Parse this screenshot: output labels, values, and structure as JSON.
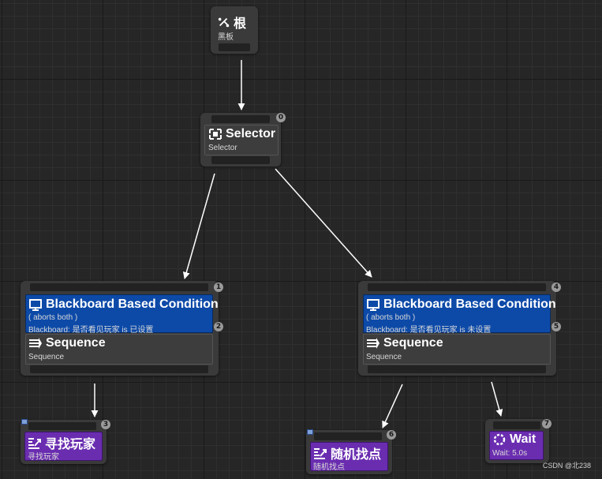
{
  "root": {
    "title": "根",
    "subtitle": "黑板"
  },
  "selector": {
    "title": "Selector",
    "subtitle": "Selector",
    "index": "0"
  },
  "left_branch": {
    "decorator": {
      "title": "Blackboard Based Condition",
      "aborts": "( aborts both )",
      "detail": "Blackboard: 是否看见玩家 is 已设置",
      "index": "2"
    },
    "composite": {
      "title": "Sequence",
      "subtitle": "Sequence",
      "index": "1"
    }
  },
  "right_branch": {
    "decorator": {
      "title": "Blackboard Based Condition",
      "aborts": "( aborts both )",
      "detail": "Blackboard: 是否看见玩家 is 未设置",
      "index": "5"
    },
    "composite": {
      "title": "Sequence",
      "subtitle": "Sequence",
      "index": "4"
    }
  },
  "tasks": [
    {
      "title": "寻找玩家",
      "subtitle": "寻找玩家",
      "index": "3",
      "icon": "move-to-icon"
    },
    {
      "title": "随机找点",
      "subtitle": "随机找点",
      "index": "6",
      "icon": "move-to-icon"
    },
    {
      "title": "Wait",
      "subtitle": "Wait: 5.0s",
      "index": "7",
      "icon": "wait-icon"
    }
  ],
  "watermark": "CSDN @北238",
  "colors": {
    "decorator": "#0d4aa8",
    "task": "#6a2db0",
    "node": "#3a3a3a",
    "wire": "#ffffff"
  }
}
